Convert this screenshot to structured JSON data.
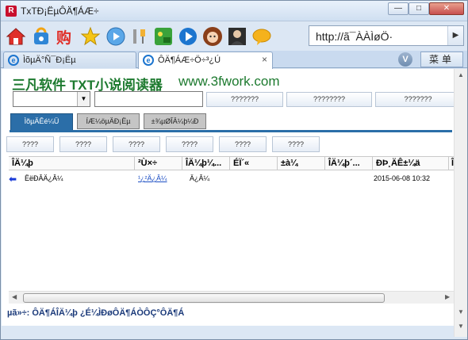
{
  "window": {
    "title": "TxTÐ¡ËµÔÄ¶ÁÆ÷",
    "minimize_label": "—",
    "maximize_label": "□",
    "close_label": "✕"
  },
  "toolbar": {
    "icons": [
      "home-icon",
      "recycle-icon",
      "shopping-icon",
      "star-icon",
      "media-icon",
      "tools-icon",
      "game-icon",
      "play-icon",
      "avatar-girl-icon",
      "photo-icon",
      "chat-icon"
    ],
    "url_text": "http://ã¯ÀÀÌøÖ·",
    "go_label": "▶"
  },
  "browser_tabs": [
    {
      "label": "ÌõµÄ°Ñ¯Ð¡Ëµ",
      "active": false
    },
    {
      "label": "ÔÄ¶ÁÆ÷Ö÷³¿Ú",
      "active": true
    }
  ],
  "browser_tab_close": "×",
  "v_button": "V",
  "menu_label": "菜单",
  "page": {
    "brand": "三凡软件 TXT小说阅读器",
    "brand_url": "www.3fwork.com",
    "search_buttons": [
      "???????",
      "????????",
      "???????"
    ],
    "nav_tabs": [
      "ÌõµÄÊé¼Ü",
      "ÍÆ¼öµÄÐ¡Ëµ",
      "±¾µØÎÄ¼þ¼Ð"
    ],
    "filter_buttons": [
      "????",
      "????",
      "????",
      "????",
      "????",
      "????"
    ],
    "table": {
      "headers": [
        "ÎÄ¼þ",
        "²Ù×÷",
        "ÎÄ¼þ¼...",
        "ÉÏ´«",
        "±à¼­",
        "ÎÄ¼þ´...",
        "ÐÞ¸ÄÊ±¼ä",
        "Î"
      ],
      "rows": [
        {
          "name": "ËëÐÂÄ¿Â¼",
          "action": "¹¿²Ä¿Â¼",
          "folder": "Ä¿Â¼",
          "date": "2015-06-08 10:32"
        }
      ]
    },
    "status": "µã»÷: ÔÄ¶ÁÎÄ¼þ ¿É¼ÌÐøÔÄ¶ÁÒÔÇ°ÔÄ¶Á"
  },
  "colors": {
    "brand_green": "#1d7a2f",
    "tab_blue": "#2b6ea8",
    "link_blue": "#1d4fc4",
    "status_blue": "#1b3a7a"
  }
}
